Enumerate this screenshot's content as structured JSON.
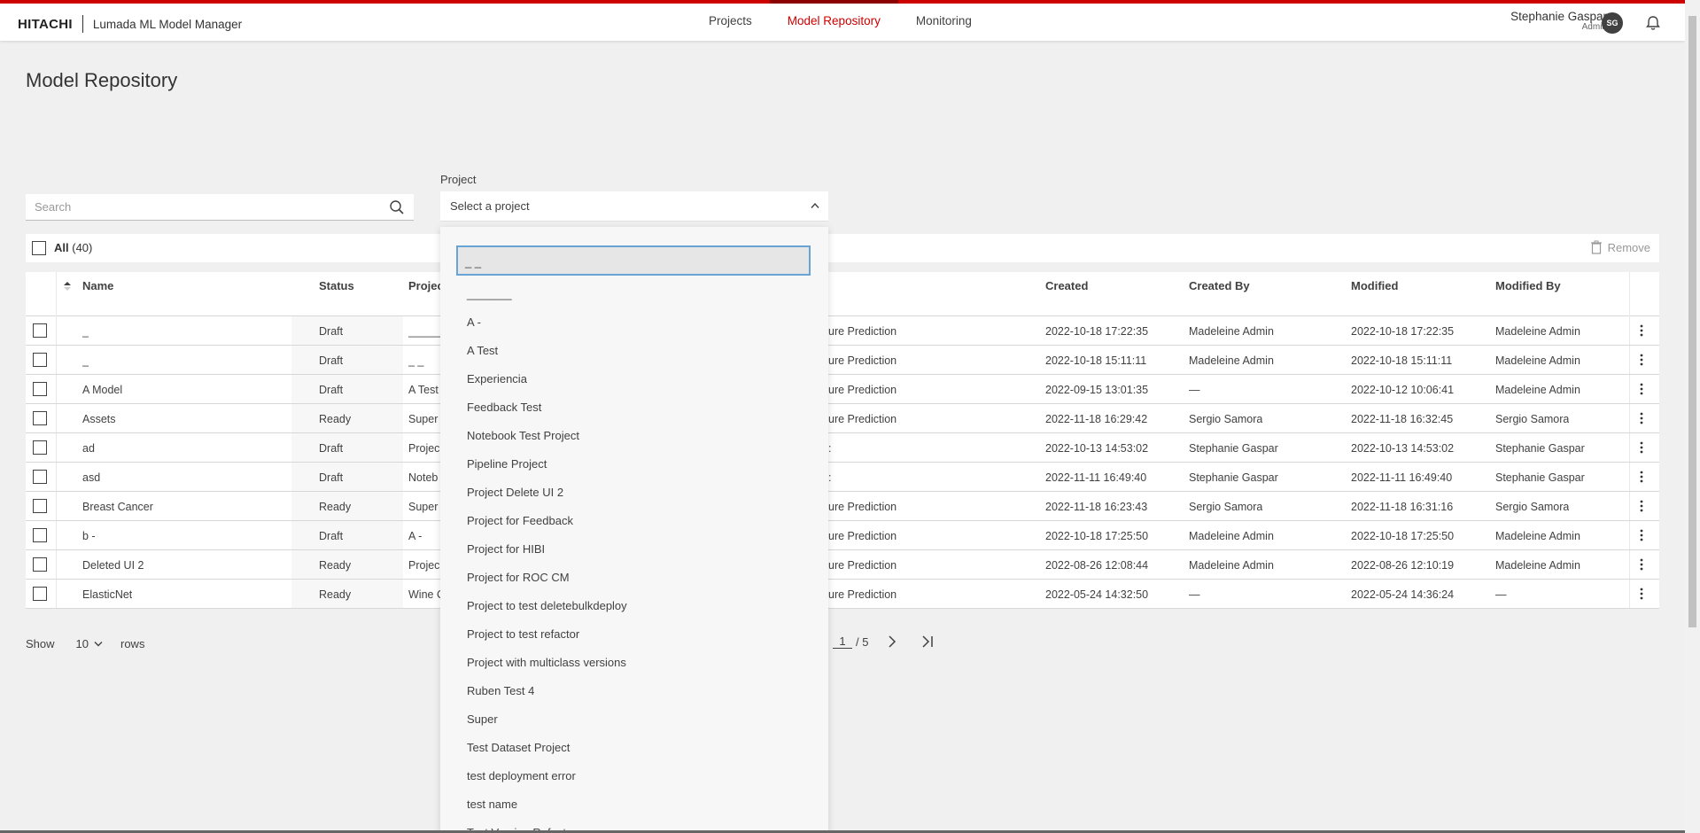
{
  "header": {
    "logo": "HITACHI",
    "app_name": "Lumada ML Model Manager",
    "nav": [
      {
        "label": "Projects",
        "active": false
      },
      {
        "label": "Model Repository",
        "active": true
      },
      {
        "label": "Monitoring",
        "active": false
      }
    ],
    "user_name": "Stephanie Gaspar",
    "user_role": "Admin",
    "avatar_initials": "SG"
  },
  "page_title": "Model Repository",
  "search": {
    "placeholder": "Search"
  },
  "project_filter": {
    "label": "Project",
    "value": "Select a project",
    "filter_text": "_ _",
    "options": [
      "_______",
      "A -",
      "A Test",
      "Experiencia",
      "Feedback Test",
      "Notebook Test Project",
      "Pipeline Project",
      "Project Delete UI 2",
      "Project for Feedback",
      "Project for HIBI",
      "Project for ROC CM",
      "Project to test deletebulkdeploy",
      "Project to test refactor",
      "Project with multiclass versions",
      "Ruben Test 4",
      "Super",
      "Test Dataset Project",
      "test deployment error",
      "test name",
      "Test Version Refactor"
    ]
  },
  "bulk": {
    "all_label": "All",
    "count_label": "(40)",
    "remove_label": "Remove"
  },
  "table": {
    "columns": {
      "name": "Name",
      "status": "Status",
      "project": "Projec",
      "created": "Created",
      "created_by": "Created By",
      "modified": "Modified",
      "modified_by": "Modified By"
    },
    "rows": [
      {
        "name": "_",
        "status": "Draft",
        "project": "______",
        "type": "ure Prediction",
        "created": "2022-10-18 17:22:35",
        "created_by": "Madeleine Admin",
        "modified": "2022-10-18 17:22:35",
        "modified_by": "Madeleine Admin"
      },
      {
        "name": "_",
        "status": "Draft",
        "project": "_ _",
        "type": "ure Prediction",
        "created": "2022-10-18 15:11:11",
        "created_by": "Madeleine Admin",
        "modified": "2022-10-18 15:11:11",
        "modified_by": "Madeleine Admin"
      },
      {
        "name": "A Model",
        "status": "Draft",
        "project": "A Test",
        "type": "ure Prediction",
        "created": "2022-09-15 13:01:35",
        "created_by": "—",
        "modified": "2022-10-12 10:06:41",
        "modified_by": "Madeleine Admin"
      },
      {
        "name": "Assets",
        "status": "Ready",
        "project": "Super",
        "type": "ure Prediction",
        "created": "2022-11-18 16:29:42",
        "created_by": "Sergio Samora",
        "modified": "2022-11-18 16:32:45",
        "modified_by": "Sergio Samora"
      },
      {
        "name": "ad",
        "status": "Draft",
        "project": "Projec",
        "type": ":",
        "created": "2022-10-13 14:53:02",
        "created_by": "Stephanie Gaspar",
        "modified": "2022-10-13 14:53:02",
        "modified_by": "Stephanie Gaspar"
      },
      {
        "name": "asd",
        "status": "Draft",
        "project": "Noteb",
        "type": ":",
        "created": "2022-11-11 16:49:40",
        "created_by": "Stephanie Gaspar",
        "modified": "2022-11-11 16:49:40",
        "modified_by": "Stephanie Gaspar"
      },
      {
        "name": "Breast Cancer",
        "status": "Ready",
        "project": "Super",
        "type": "ure Prediction",
        "created": "2022-11-18 16:23:43",
        "created_by": "Sergio Samora",
        "modified": "2022-11-18 16:31:16",
        "modified_by": "Sergio Samora"
      },
      {
        "name": "b -",
        "status": "Draft",
        "project": "A -",
        "type": "ure Prediction",
        "created": "2022-10-18 17:25:50",
        "created_by": "Madeleine Admin",
        "modified": "2022-10-18 17:25:50",
        "modified_by": "Madeleine Admin"
      },
      {
        "name": "Deleted UI 2",
        "status": "Ready",
        "project": "Projec",
        "type": "ure Prediction",
        "created": "2022-08-26 12:08:44",
        "created_by": "Madeleine Admin",
        "modified": "2022-08-26 12:10:19",
        "modified_by": "Madeleine Admin"
      },
      {
        "name": "ElasticNet",
        "status": "Ready",
        "project": "Wine C",
        "type": "ure Prediction",
        "created": "2022-05-24 14:32:50",
        "created_by": "—",
        "modified": "2022-05-24 14:36:24",
        "modified_by": "—"
      }
    ]
  },
  "pagination": {
    "show_label": "Show",
    "rows_value": "10",
    "rows_label": "rows",
    "current_page": "1",
    "total_label": "/ 5"
  }
}
